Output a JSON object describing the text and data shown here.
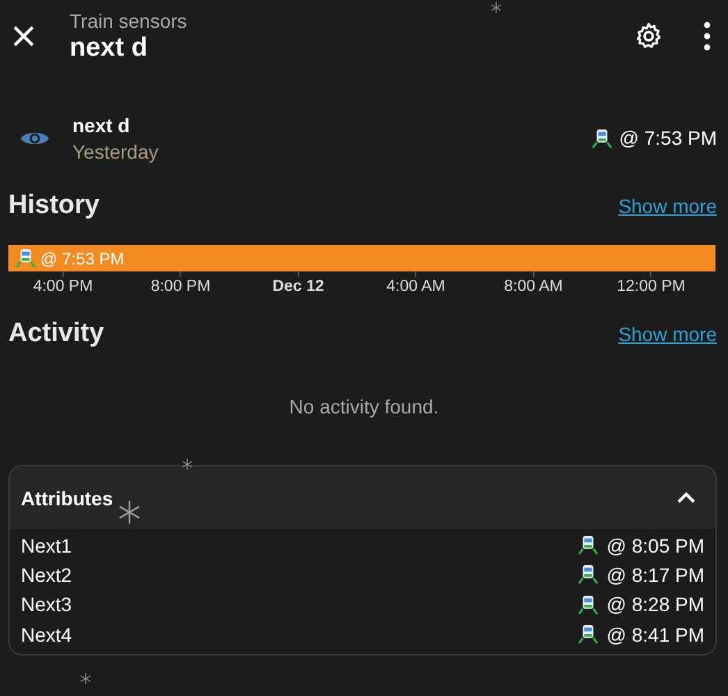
{
  "header": {
    "subtitle": "Train sensors",
    "title": "next d"
  },
  "entity": {
    "name": "next d",
    "time": "Yesterday",
    "value": "@ 7:53 PM"
  },
  "history": {
    "title": "History",
    "link": "Show more",
    "segments": [
      {
        "label": "@ 7:53 PM",
        "color": "#f28b22"
      }
    ],
    "ticks": [
      {
        "label": "4:00 PM",
        "bold": false
      },
      {
        "label": "8:00 PM",
        "bold": false
      },
      {
        "label": "Dec 12",
        "bold": true
      },
      {
        "label": "4:00 AM",
        "bold": false
      },
      {
        "label": "8:00 AM",
        "bold": false
      },
      {
        "label": "12:00 PM",
        "bold": false
      }
    ]
  },
  "activity": {
    "title": "Activity",
    "link": "Show more",
    "empty": "No activity found."
  },
  "attributes": {
    "title": "Attributes",
    "expanded": true,
    "rows": [
      {
        "name": "Next1",
        "value": "@ 8:05 PM"
      },
      {
        "name": "Next2",
        "value": "@ 8:17 PM"
      },
      {
        "name": "Next3",
        "value": "@ 8:28 PM"
      },
      {
        "name": "Next4",
        "value": "@ 8:41 PM"
      }
    ]
  }
}
